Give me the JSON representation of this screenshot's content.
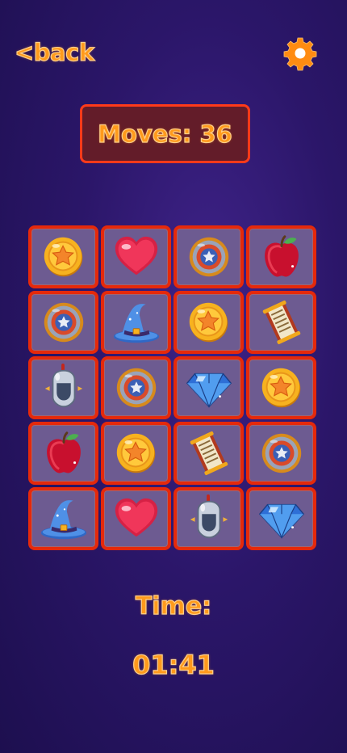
{
  "header": {
    "back_label": "<back",
    "settings_icon": "gear-icon"
  },
  "moves": {
    "label": "Moves: 36",
    "value": 36
  },
  "board": {
    "rows": 5,
    "columns": 4,
    "cards": [
      "coin-icon",
      "heart-icon",
      "shield-icon",
      "apple-icon",
      "shield-icon",
      "wizard-hat-icon",
      "coin-icon",
      "scroll-icon",
      "helmet-icon",
      "shield-icon",
      "diamond-icon",
      "coin-icon",
      "apple-icon",
      "coin-icon",
      "scroll-icon",
      "shield-icon",
      "wizard-hat-icon",
      "heart-icon",
      "helmet-icon",
      "diamond-icon"
    ]
  },
  "timer": {
    "label": "Time:",
    "value": "01:41"
  },
  "colors": {
    "accent": "#ff9a1c",
    "card_border": "#e5290b",
    "card_fill": "#6d5b91",
    "moves_box": "#631c29",
    "background": "#2b1669"
  }
}
